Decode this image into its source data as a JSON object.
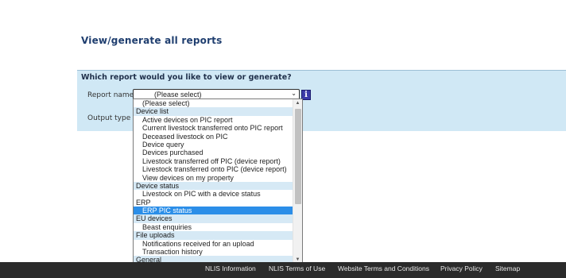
{
  "page": {
    "title": "View/generate all reports"
  },
  "form": {
    "heading": "Which report would you like to view or generate?",
    "report_name_label": "Report name",
    "output_type_label": "Output type",
    "select": {
      "value": "(Please select)",
      "arrow": "⌄"
    },
    "info_icon": "i"
  },
  "dropdown": {
    "rows": [
      {
        "type": "option",
        "text": "(Please select)"
      },
      {
        "type": "group",
        "text": "Device list"
      },
      {
        "type": "option",
        "text": "Active devices on PIC report"
      },
      {
        "type": "option",
        "text": "Current livestock transferred onto PIC report"
      },
      {
        "type": "option",
        "text": "Deceased livestock on PIC"
      },
      {
        "type": "option",
        "text": "Device query"
      },
      {
        "type": "option",
        "text": "Devices purchased"
      },
      {
        "type": "option",
        "text": "Livestock transferred off PIC (device report)"
      },
      {
        "type": "option",
        "text": "Livestock transferred onto PIC (device report)"
      },
      {
        "type": "option",
        "text": "View devices on my property"
      },
      {
        "type": "group",
        "text": "Device status"
      },
      {
        "type": "option",
        "text": "Livestock on PIC with a device status"
      },
      {
        "type": "group-plain",
        "text": "ERP"
      },
      {
        "type": "selected",
        "text": "ERP PIC status"
      },
      {
        "type": "group",
        "text": "EU devices"
      },
      {
        "type": "option",
        "text": "Beast enquiries"
      },
      {
        "type": "group",
        "text": "File uploads"
      },
      {
        "type": "option",
        "text": "Notifications received for an upload"
      },
      {
        "type": "option",
        "text": "Transaction history"
      },
      {
        "type": "group",
        "text": "General"
      }
    ],
    "scroll_up": "▲",
    "scroll_down": "▼",
    "selected_color": "#2b8ee8",
    "group_color": "#d6e9f5"
  },
  "footer": {
    "links": [
      "NLIS Information",
      "NLIS Terms of Use",
      "Website Terms and Conditions",
      "Privacy Policy",
      "Sitemap"
    ]
  }
}
